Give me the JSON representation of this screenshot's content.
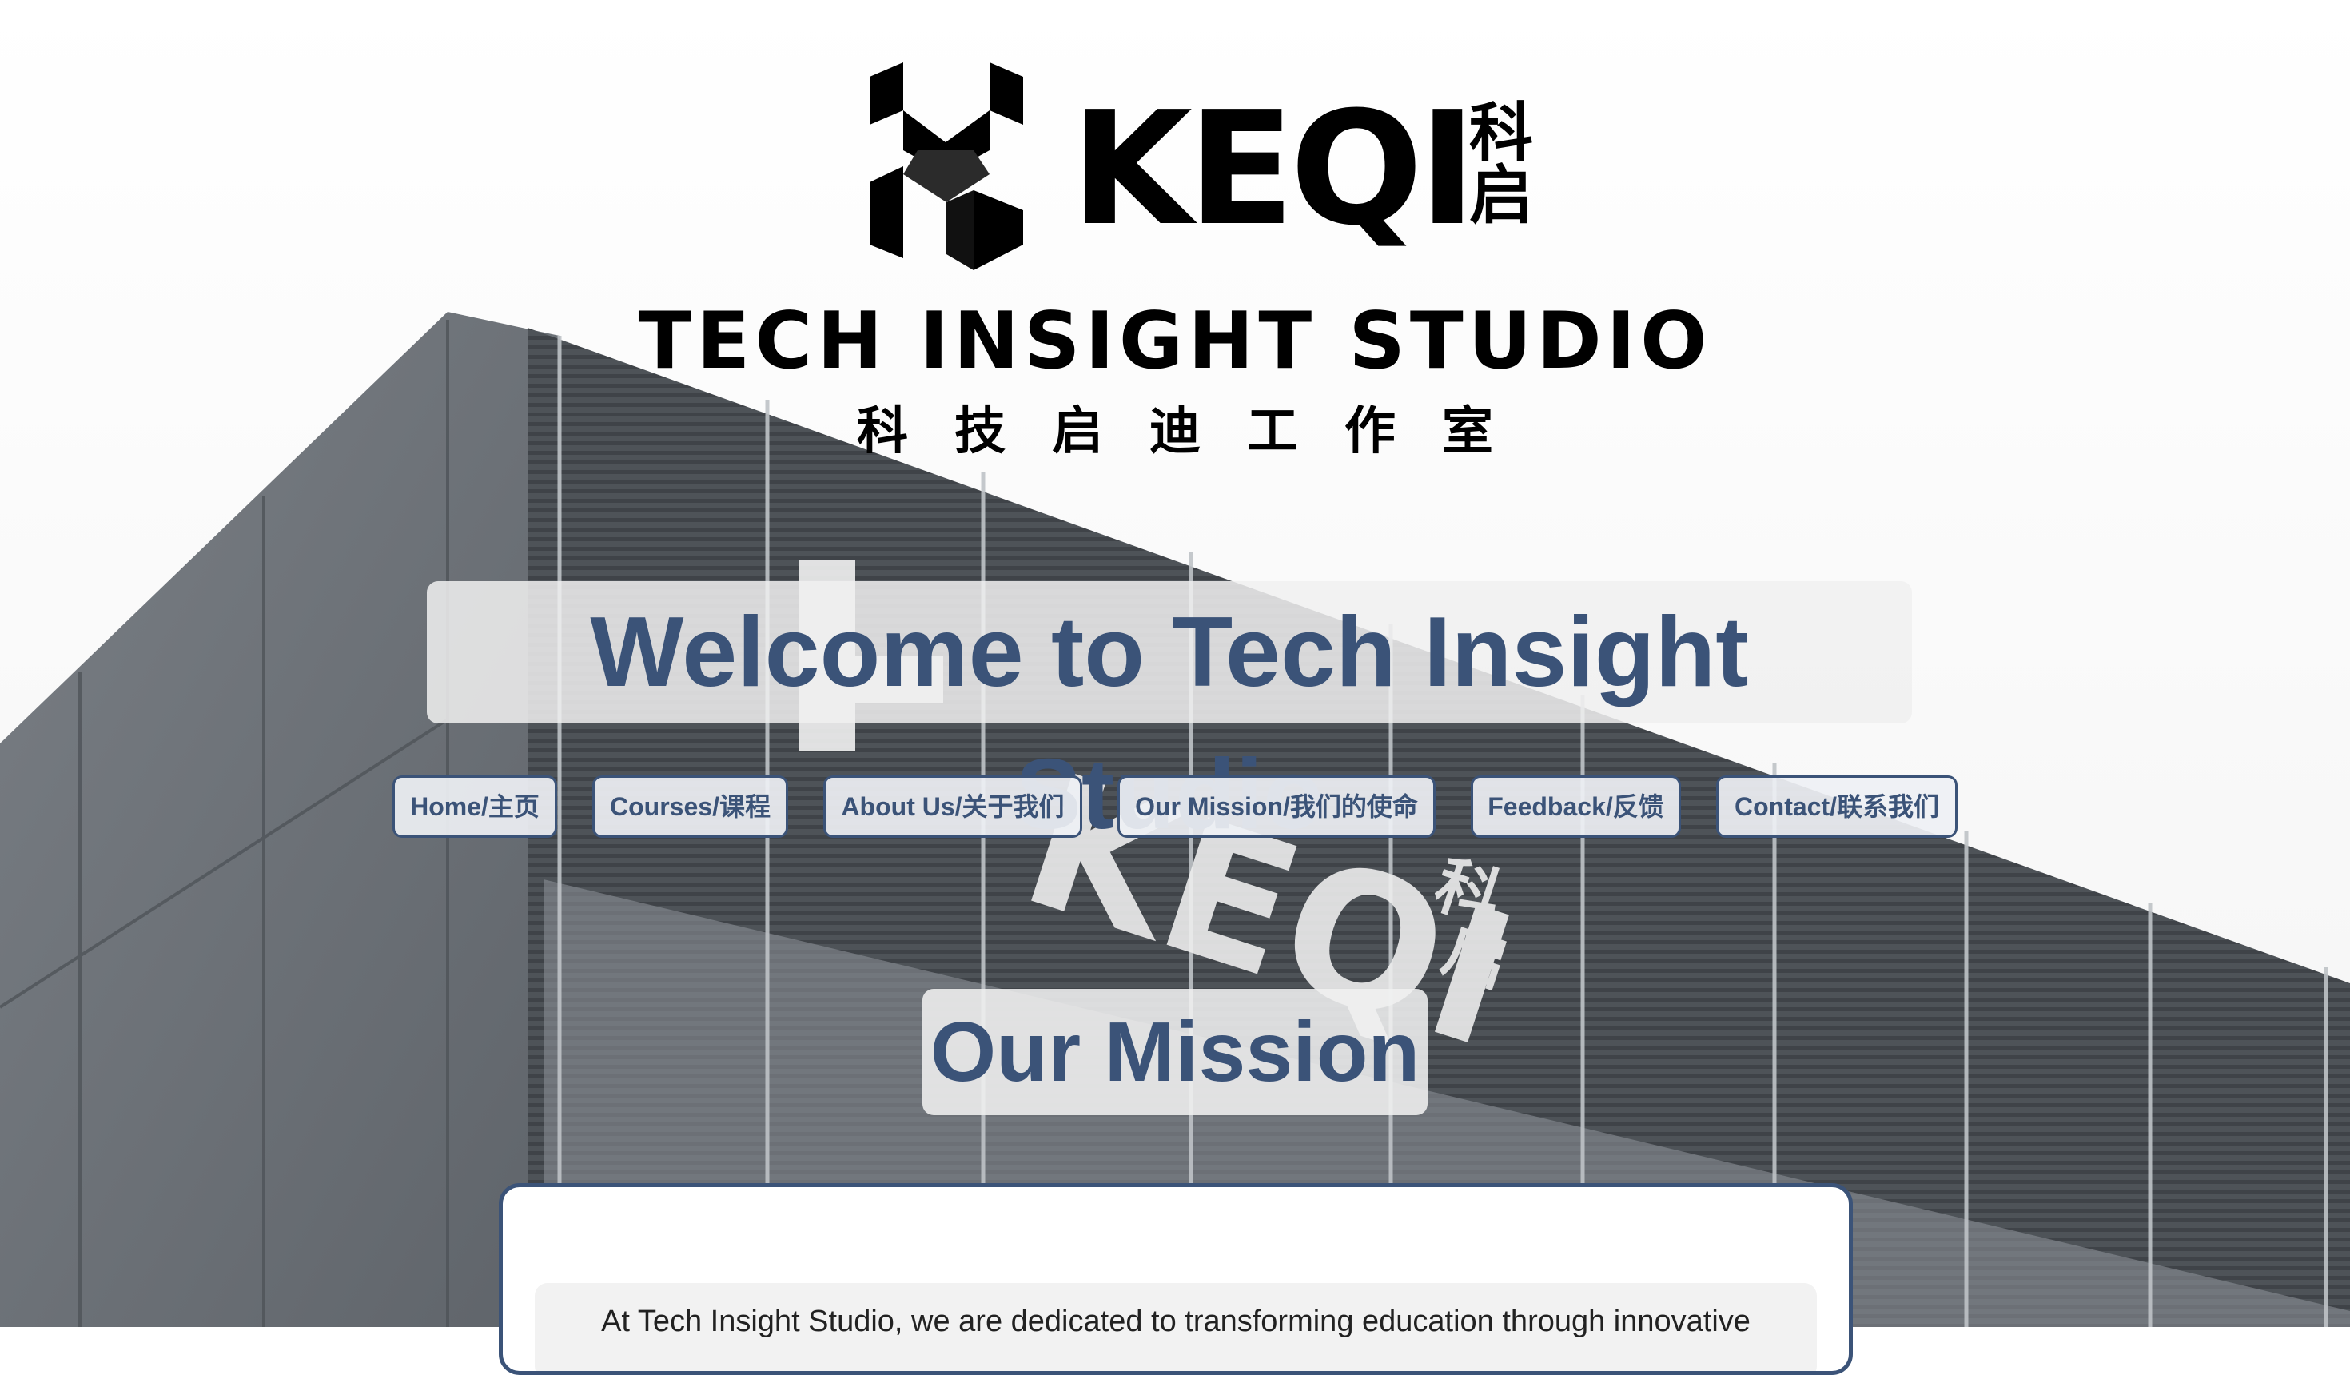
{
  "logo": {
    "wordmark": "KEQI",
    "wordmark_cn": "科启",
    "line1": "TECH INSIGHT STUDIO",
    "line2": "科技启迪工作室"
  },
  "hero": {
    "title": "Welcome to Tech Insight Studio"
  },
  "nav": {
    "items": [
      {
        "label": "Home/主页"
      },
      {
        "label": "Courses/课程"
      },
      {
        "label": "About Us/关于我们"
      },
      {
        "label": "Our Mission/我们的使命"
      },
      {
        "label": "Feedback/反馈"
      },
      {
        "label": "Contact/联系我们"
      }
    ]
  },
  "mission": {
    "title": "Our Mission",
    "text": "At Tech Insight Studio, we are dedicated to transforming education through innovative"
  },
  "colors": {
    "accent": "#3b5378",
    "panel": "#f0f0f0"
  }
}
